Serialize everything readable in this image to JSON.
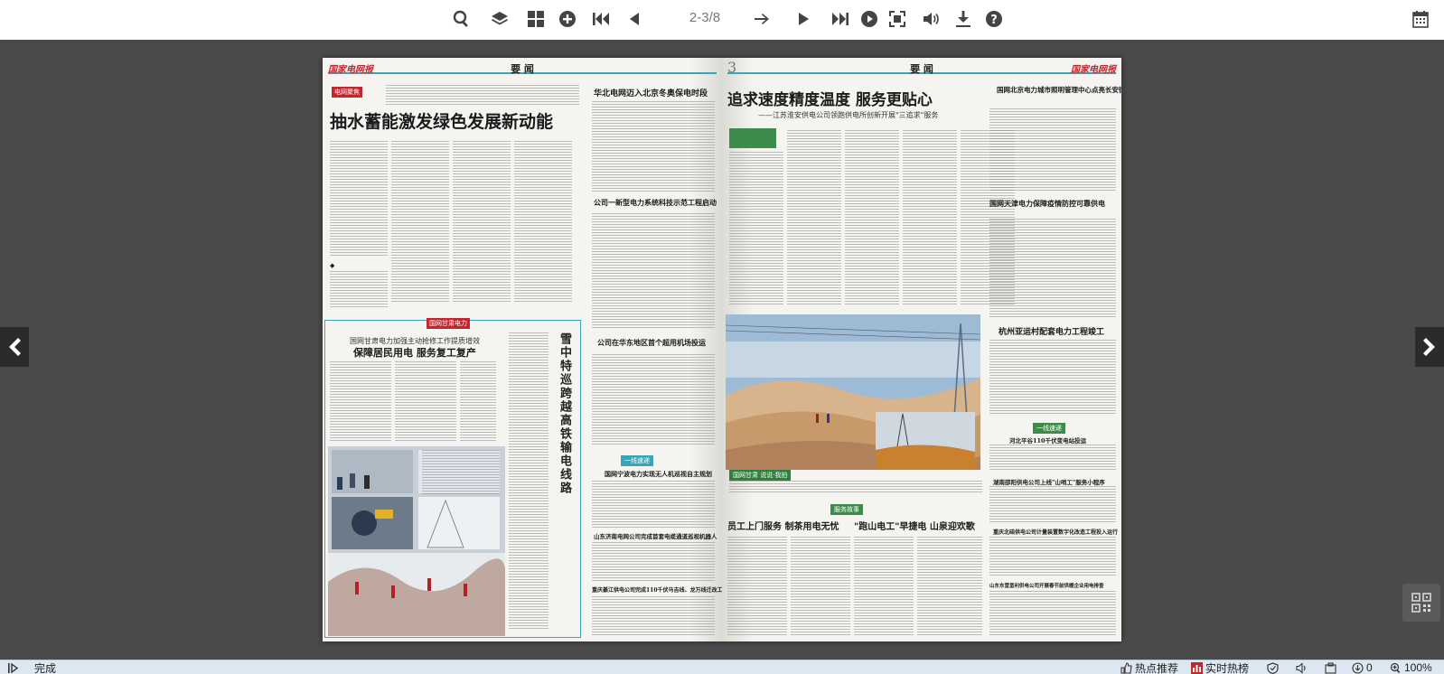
{
  "toolbar": {
    "buttons": [
      "search-icon",
      "layers-icon",
      "grid-icon",
      "add-circle-icon",
      "first-page-icon",
      "previous-icon",
      "arrow-right-icon",
      "play-icon",
      "last-page-icon",
      "autoplay-icon",
      "fullscreen-icon",
      "volume-icon",
      "download-icon",
      "help-icon",
      "calendar-icon"
    ],
    "page_indicator": "2-3/8"
  },
  "viewer": {
    "left_page": {
      "masthead": "国家电网报",
      "section": "要 闻",
      "lead_tag": "电网聚焦",
      "headline": "抽水蓄能激发绿色发展新动能",
      "side_headline_1": "华北电网迈入北京冬奥保电时段",
      "side_headline_2": "公司一新型电力系统科技示范工程启动",
      "side_headline_3": "公司在华东地区首个超用机场投运",
      "feature_kicker": "国网甘肃电力",
      "feature_subhead": "国网甘肃电力加强主动抢修工作提质增效",
      "feature_headline": "保障居民用电 服务复工复产",
      "vertical_headline": "雪中特巡跨越高铁输电线路",
      "small_tag": "一线速递",
      "bottom_headline_1": "国网宁波电力实现无人机巡视自主规划",
      "bottom_headline_2": "山东济南电网公司完成首套电缆通道巡视机器人",
      "bottom_headline_3": "重庆綦江供电公司完成110千伏马吉线、龙万线迁改工程"
    },
    "right_page": {
      "masthead": "国家电网报",
      "section": "要 闻",
      "page_number": "3",
      "headline": "追求速度精度温度 服务更贴心",
      "subhead": "——江苏淮安供电公司领跑供电所创新开展\"三追求\"服务",
      "photo_caption": "国网甘肃 说说·我拍",
      "side_headline_1": "国网北京电力城市照明管理中心点亮长安街春节景观",
      "side_headline_2": "国网天津电力保障疫情防控可靠供电",
      "side_headline_3": "杭州亚运村配套电力工程竣工",
      "small_tag": "一线速递",
      "brief_1": "河北平谷110千伏变电站投运",
      "brief_2": "湖南邵阳供电公司上线\"山哨工\"服务小程序",
      "brief_3": "重庆北碚供电公司计量装置数字化改造工程投入运行",
      "brief_4": "山东东营垦利供电公司开展春节前供暖企业用电排查",
      "story_label": "服务故事",
      "bottom_headline_1": "员工上门服务 制茶用电无忧",
      "bottom_headline_2": "\"跑山电工\"早捷电 山泉迎欢歌"
    }
  },
  "statusbar": {
    "left_label": "完成",
    "hot_recommend": "热点推荐",
    "realtime_hot": "实时热榜",
    "download_count": "0",
    "zoom": "100%"
  },
  "colors": {
    "accent_teal": "#3aa6b5",
    "masthead_red": "#c4262e",
    "viewer_bg": "#4a4a4a"
  }
}
